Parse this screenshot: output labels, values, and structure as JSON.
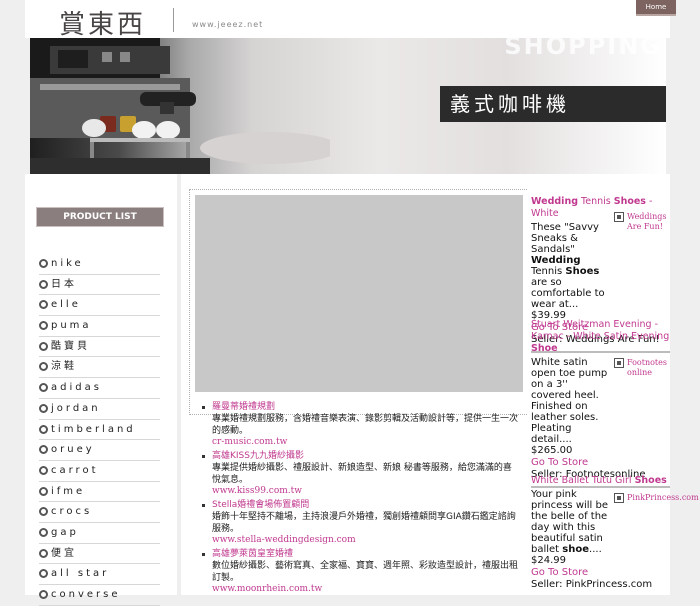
{
  "header": {
    "logo": "賞東西",
    "url": "www.jeeez.net",
    "home": "Home"
  },
  "banner": {
    "ghost_text": "SHOPPING",
    "title": "義式咖啡機"
  },
  "sidebar": {
    "product_list": "PRODUCT LIST",
    "items": [
      {
        "label": "nike"
      },
      {
        "label": "日本"
      },
      {
        "label": "elle"
      },
      {
        "label": "puma"
      },
      {
        "label": "酷寶貝"
      },
      {
        "label": "涼鞋"
      },
      {
        "label": "adidas"
      },
      {
        "label": "jordan"
      },
      {
        "label": "timberland"
      },
      {
        "label": "oruey"
      },
      {
        "label": "carrot"
      },
      {
        "label": "ifme"
      },
      {
        "label": "crocs"
      },
      {
        "label": "gap"
      },
      {
        "label": "便宜"
      },
      {
        "label": "all star"
      },
      {
        "label": "converse"
      }
    ]
  },
  "links": [
    {
      "title": "羅曼蒂婚禮規劃",
      "desc": "專業婚禮規劃服務，含婚禮音樂表演、錄影剪輯及活動設計等，提供一生一次的感動。",
      "url": "cr-music.com.tw"
    },
    {
      "title": "高雄KISS九九婚紗攝影",
      "desc": "專業提供婚紗攝影、禮服設計、新娘造型、新娘 秘書等服務，給您滿滿的喜悅氣息。",
      "url": "www.kiss99.com.tw"
    },
    {
      "title": "Stella婚禮會場佈置顧問",
      "desc": "婚飾十年堅持不離場，主持浪漫戶外婚禮，獨創婚禮顧問享GIA鑽石鑑定諮詢服務。",
      "url": "www.stella-weddingdesign.com"
    },
    {
      "title": "高雄夢萊茵皇室婚禮",
      "desc": "數位婚紗攝影、藝術寫真、全家福、寶寶、週年照、彩妝造型設計，禮服出租訂製。",
      "url": "www.moonrhein.com.tw"
    }
  ],
  "products": [
    {
      "title_pre": "Wedding",
      "title_mid": " Tennis ",
      "title_kw": "Shoes",
      "title_post": " - White",
      "body_pre": "These \"Savvy Sneaks & Sandals\" ",
      "body_kw1": "Wedding",
      "body_mid": " Tennis ",
      "body_kw2": "Shoes",
      "body_post": " are so comfortable to wear at...",
      "price": "$39.99",
      "goto": "Go To Store",
      "seller": "Seller: Weddings Are Fun!",
      "merchant": "Weddings Are Fun!"
    },
    {
      "title_pre": "Stuart Weitzman Evening - Karnac - White Satin Evening ",
      "title_kw": "Shoe",
      "body": "White satin open toe pump on a 3'' covered heel. Finished on leather soles. Pleating detail....",
      "price": "$265.00",
      "goto": "Go To Store",
      "seller": "Seller: Footnotesonline",
      "merchant": "Footnotes online"
    },
    {
      "title_pre": "White Ballet Tutu Girl ",
      "title_kw": "Shoes",
      "body_pre": "Your pink princess will be the belle of the day with this beautiful satin ballet ",
      "body_kw": "shoe",
      "body_post": "....",
      "price": "$24.99",
      "goto": "Go To Store",
      "seller": "Seller: PinkPrincess.com",
      "merchant": "PinkPrincess.com"
    }
  ]
}
